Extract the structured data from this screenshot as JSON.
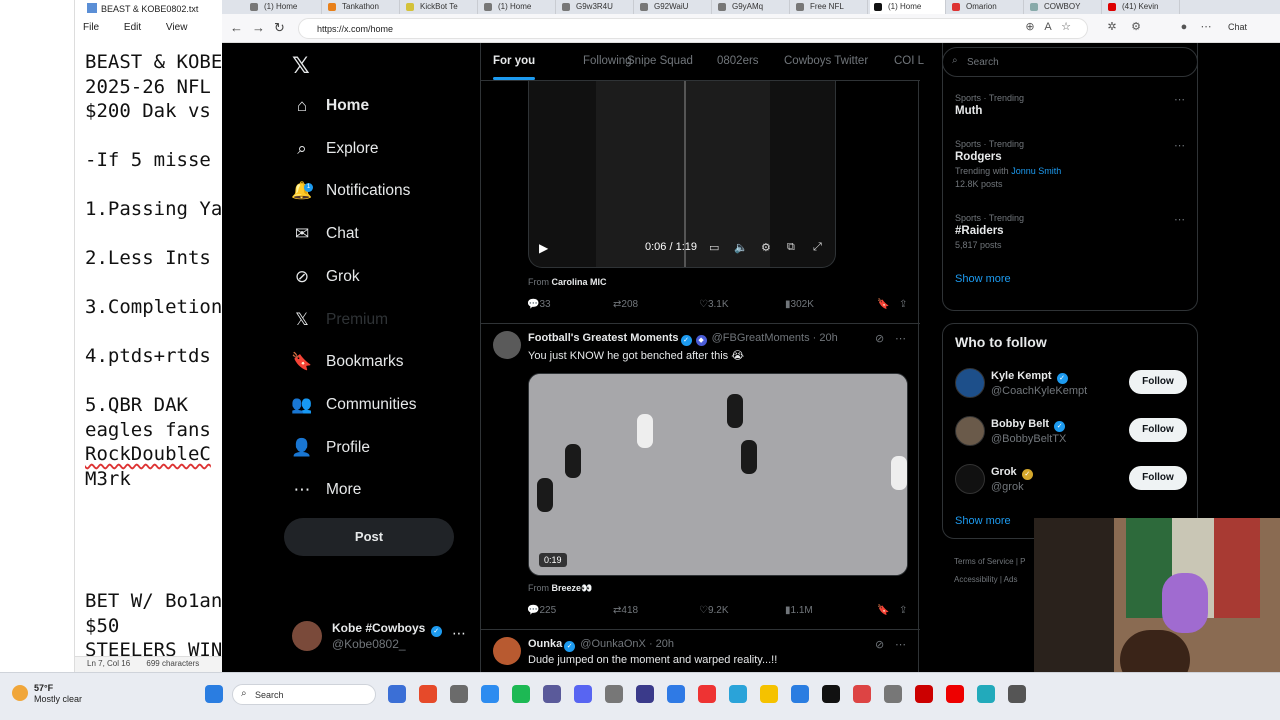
{
  "notepad": {
    "title": "BEAST & KOBE0802.txt",
    "menu": [
      "File",
      "Edit",
      "View"
    ],
    "lines": [
      "BEAST & KOBE",
      "2025-26 NFL",
      "$200 Dak vs",
      "",
      "-If 5 misse",
      "",
      "1.Passing Ya",
      "",
      "2.Less Ints",
      "",
      "3.Completion",
      "",
      "4.ptds+rtds",
      "",
      "5.QBR DAK",
      "eagles fans",
      "RockDoubleC",
      "M3rk",
      "",
      "",
      "",
      "",
      "BET W/ Bo1an",
      "$50",
      "STEELERS WIN"
    ],
    "status": {
      "position": "Ln 7, Col 16",
      "chars": "699 characters"
    }
  },
  "browser": {
    "tabs": [
      "(1) Home",
      "Tankathon",
      "KickBot Te",
      "(1) Home",
      "G9w3R4U",
      "G92WaiU",
      "G9yAMq",
      "Free NFL",
      "(1) Home",
      "Omarion",
      "COWBOY",
      "(41) Kevin"
    ],
    "url": "https://x.com/home",
    "chat_label": "Chat"
  },
  "x": {
    "nav": [
      {
        "label": "Home",
        "icon": "home-icon"
      },
      {
        "label": "Explore",
        "icon": "search-icon"
      },
      {
        "label": "Notifications",
        "icon": "bell-icon",
        "badge": "1"
      },
      {
        "label": "Chat",
        "icon": "mail-icon"
      },
      {
        "label": "Grok",
        "icon": "grok-icon"
      },
      {
        "label": "Premium",
        "icon": "x-icon"
      },
      {
        "label": "Bookmarks",
        "icon": "bookmark-icon"
      },
      {
        "label": "Communities",
        "icon": "people-icon"
      },
      {
        "label": "Profile",
        "icon": "person-icon"
      },
      {
        "label": "More",
        "icon": "more-icon"
      }
    ],
    "post_label": "Post",
    "account": {
      "name": "Kobe #Cowboys",
      "handle": "@Kobe0802_"
    },
    "tabs": [
      "For you",
      "Following",
      "Snipe Squad",
      "0802ers",
      "Cowboys Twitter",
      "COI L"
    ],
    "tweet1": {
      "video_time": "0:06 / 1:19",
      "from_prefix": "From",
      "from": "Carolina MIC",
      "replies": "33",
      "reposts": "208",
      "likes": "3.1K",
      "views": "302K"
    },
    "tweet2": {
      "name": "Football's Greatest Moments",
      "handle": "@FBGreatMoments · 20h",
      "text": "You just KNOW he got benched after this 😭",
      "duration": "0:19",
      "from_prefix": "From",
      "from": "Breeze👀",
      "replies": "225",
      "reposts": "418",
      "likes": "9.2K",
      "views": "1.1M"
    },
    "tweet3": {
      "name": "Ounka",
      "handle": "@OunkaOnX · 20h",
      "text": "Dude jumped on the moment and warped reality...!!"
    },
    "search_placeholder": "Search",
    "trends": [
      {
        "category": "Sports · Trending",
        "title": "Muth",
        "sub": "",
        "posts": ""
      },
      {
        "category": "Sports · Trending",
        "title": "Rodgers",
        "sub": "Trending with",
        "link": "Jonnu Smith",
        "posts": "12.8K posts"
      },
      {
        "category": "Sports · Trending",
        "title": "#Raiders",
        "sub": "",
        "posts": "5,817 posts"
      }
    ],
    "show_more": "Show more",
    "who_to_follow": {
      "title": "Who to follow",
      "people": [
        {
          "name": "Kyle Kempt",
          "handle": "@CoachKyleKempt",
          "button": "Follow"
        },
        {
          "name": "Bobby Belt",
          "handle": "@BobbyBeltTX",
          "button": "Follow"
        },
        {
          "name": "Grok",
          "handle": "@grok",
          "button": "Follow"
        }
      ],
      "show_more": "Show more"
    },
    "footer": [
      "Terms of Service",
      "|",
      "P",
      "Accessibility",
      "|",
      "Ads"
    ]
  },
  "taskbar": {
    "temp": "57°F",
    "weather": "Mostly clear",
    "search": "Search"
  }
}
